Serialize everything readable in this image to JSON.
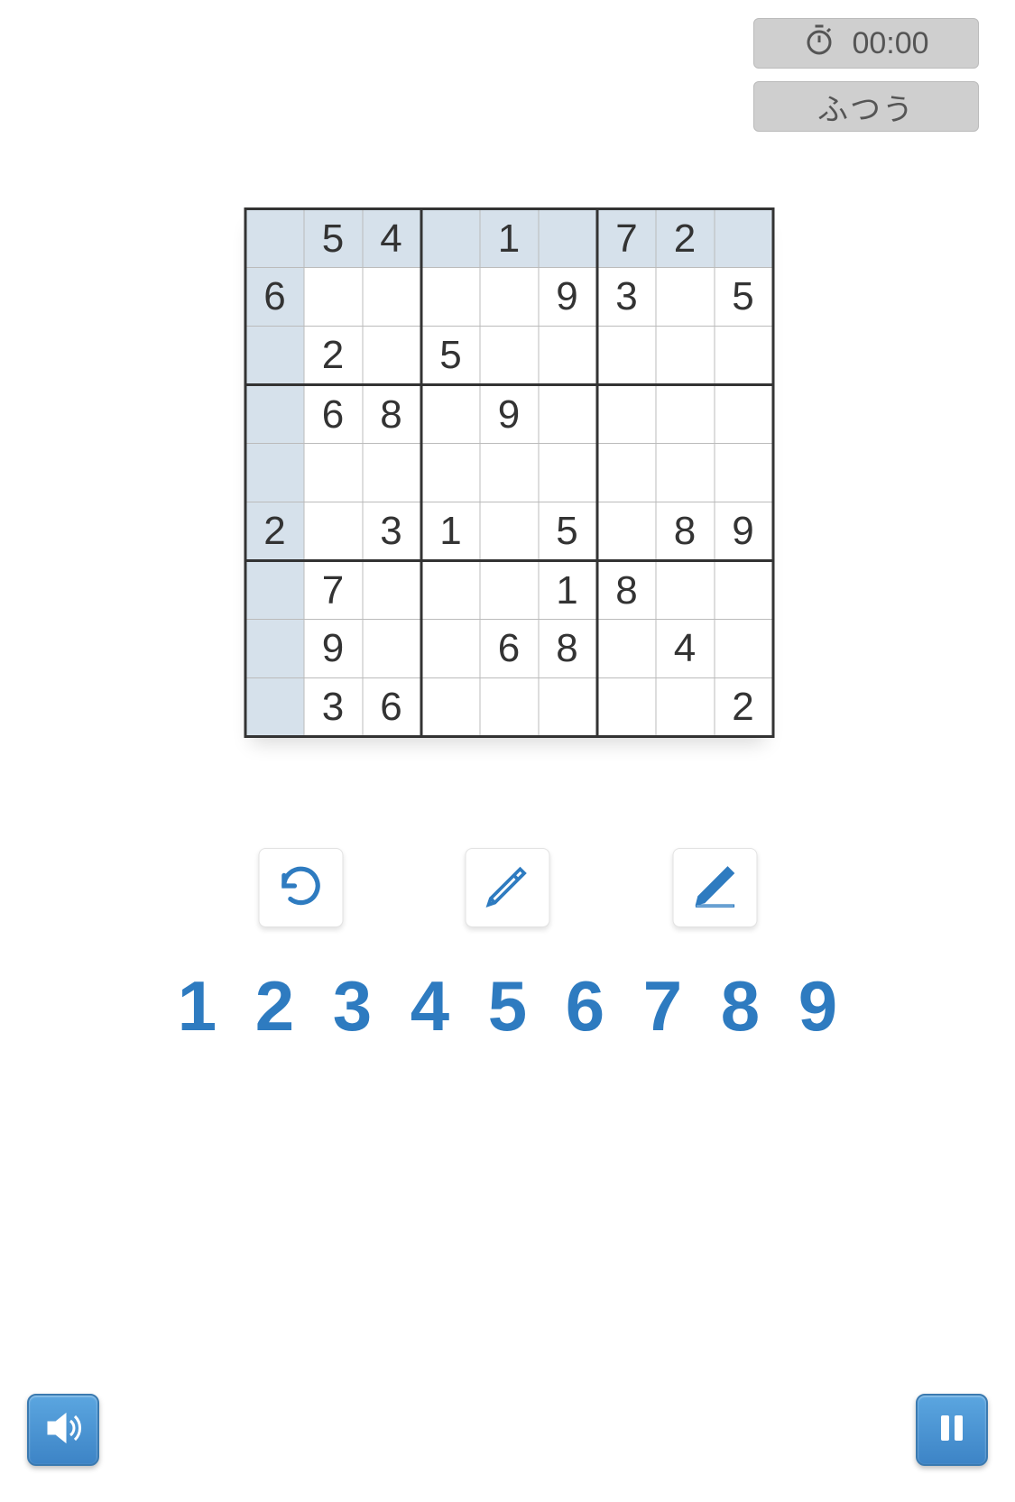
{
  "header": {
    "timer": "00:00",
    "difficulty": "ふつう"
  },
  "grid": {
    "cells": [
      [
        "",
        "5",
        "4",
        "",
        "1",
        "",
        "7",
        "2",
        ""
      ],
      [
        "6",
        "",
        "",
        "",
        "",
        "9",
        "3",
        "",
        "5"
      ],
      [
        "",
        "2",
        "",
        "5",
        "",
        "",
        "",
        "",
        ""
      ],
      [
        "",
        "6",
        "8",
        "",
        "9",
        "",
        "",
        "",
        ""
      ],
      [
        "",
        "",
        "",
        "",
        "",
        "",
        "",
        "",
        ""
      ],
      [
        "2",
        "",
        "3",
        "1",
        "",
        "5",
        "",
        "8",
        "9"
      ],
      [
        "",
        "7",
        "",
        "",
        "",
        "1",
        "8",
        "",
        ""
      ],
      [
        "",
        "9",
        "",
        "",
        "6",
        "8",
        "",
        "4",
        ""
      ],
      [
        "",
        "3",
        "6",
        "",
        "",
        "",
        "",
        "",
        "2"
      ]
    ],
    "highlight": {
      "row0": true,
      "col0": true
    }
  },
  "numpad": [
    "1",
    "2",
    "3",
    "4",
    "5",
    "6",
    "7",
    "8",
    "9"
  ],
  "icons": {
    "stopwatch": "stopwatch-icon",
    "undo": "undo-icon",
    "pencil_notes": "pencil-notes-icon",
    "pencil_write": "pencil-write-icon",
    "sound": "sound-icon",
    "pause": "pause-icon"
  },
  "colors": {
    "accent": "#2e7bc0",
    "button_blue": "#4a8fca",
    "cell_highlight": "#d6e1eb"
  }
}
